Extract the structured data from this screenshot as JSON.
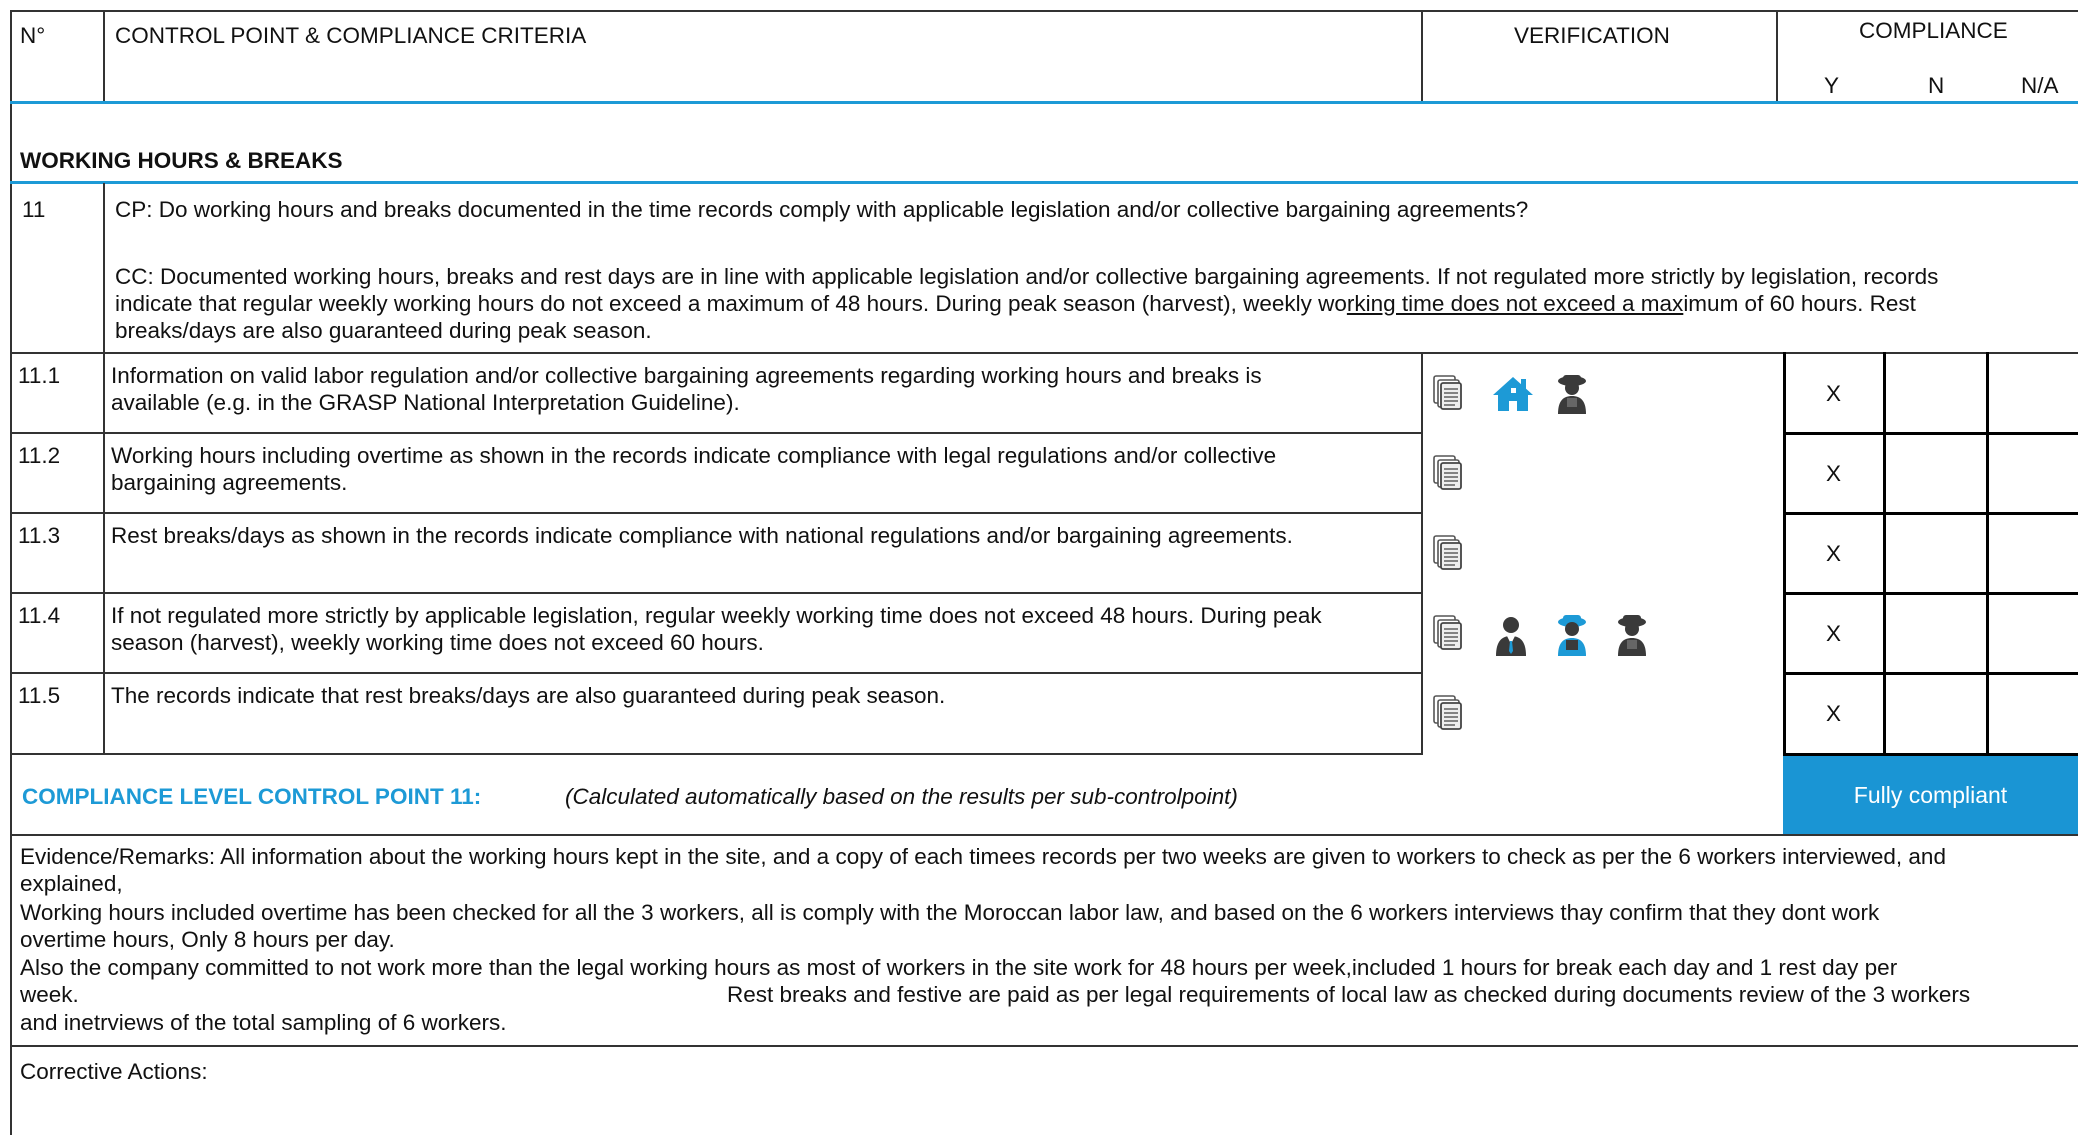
{
  "header": {
    "no": "N°",
    "cp_cc": "CONTROL POINT & COMPLIANCE CRITERIA",
    "verification": "VERIFICATION",
    "compliance": "COMPLIANCE",
    "y": "Y",
    "n": "N",
    "na": "N/A"
  },
  "section": {
    "title": "WORKING HOURS & BREAKS"
  },
  "control_point": {
    "number": "11",
    "cp": "CP: Do working hours and breaks documented in the time records comply with applicable legislation and/or collective bargaining agreements?",
    "cc_line1": "CC: Documented working hours, breaks and rest days are in line with applicable legislation and/or collective bargaining agreements. If not regulated more strictly by legislation, records",
    "cc_line2_a": "indicate that regular weekly working hours do not exceed a maximum of 48 hours. During peak season (harvest), weekly wo",
    "cc_line2_u": "rking time does not exceed a max",
    "cc_line2_b": "imum of 60 hours. Rest",
    "cc_line3": "breaks/days are also guaranteed during peak season."
  },
  "sub_points": [
    {
      "number": "11.1",
      "line1": "Information on valid labor regulation and/or collective bargaining agreements regarding working hours and breaks is",
      "line2": "available (e.g. in the GRASP National Interpretation Guideline).",
      "y": "X",
      "n": "",
      "na": "",
      "icons": [
        "documents-icon",
        "house-icon",
        "worker-icon"
      ]
    },
    {
      "number": "11.2",
      "line1": "Working hours including overtime as shown in the records indicate compliance with legal regulations and/or collective",
      "line2": "bargaining agreements.",
      "y": "X",
      "n": "",
      "na": "",
      "icons": [
        "documents-icon"
      ]
    },
    {
      "number": "11.3",
      "line1": "Rest breaks/days as shown in the records indicate compliance with national regulations and/or bargaining agreements.",
      "line2": "",
      "y": "X",
      "n": "",
      "na": "",
      "icons": [
        "documents-icon"
      ]
    },
    {
      "number": "11.4",
      "line1": "If not regulated more strictly by applicable legislation, regular weekly working time does not exceed 48 hours. During peak",
      "line2": "season (harvest), weekly working time does not exceed 60 hours.",
      "y": "X",
      "n": "",
      "na": "",
      "icons": [
        "documents-icon",
        "manager-icon",
        "worker-blue-icon",
        "worker-icon"
      ]
    },
    {
      "number": "11.5",
      "line1": "The records indicate that rest breaks/days are also guaranteed during peak season.",
      "line2": "",
      "y": "X",
      "n": "",
      "na": "",
      "icons": [
        "documents-icon"
      ]
    }
  ],
  "compliance_level": {
    "label": "COMPLIANCE LEVEL CONTROL POINT 11:",
    "note": "(Calculated automatically based on the results per sub-controlpoint)",
    "result": "Fully compliant"
  },
  "evidence": {
    "line1": "Evidence/Remarks: All information about the working hours kept in the site, and a copy of each timees records per two weeks are given to workers to check as per the 6 workers interviewed, and",
    "line2": "explained,",
    "line3": "Working hours included overtime has been checked for all the 3 workers, all is comply with the Moroccan labor law, and based on the 6 workers interviews thay confirm that they dont work",
    "line4": "overtime hours, Only 8 hours per day.",
    "line5": "Also the company committed to not work more than the legal working hours as most of workers in the site work for 48 hours per week,included 1 hours for break each day and 1 rest day per",
    "line6a": "week.",
    "line6b": "Rest breaks and festive are paid as per legal requirements of local law as checked during documents review of the 3 workers",
    "line7": "and inetrviews of the total sampling of 6 workers."
  },
  "corrective": {
    "label": "Corrective Actions:"
  },
  "colors": {
    "accent": "#1d9ad6",
    "icon_dark": "#3a3a3a",
    "badge_bg": "#1a95d4"
  }
}
